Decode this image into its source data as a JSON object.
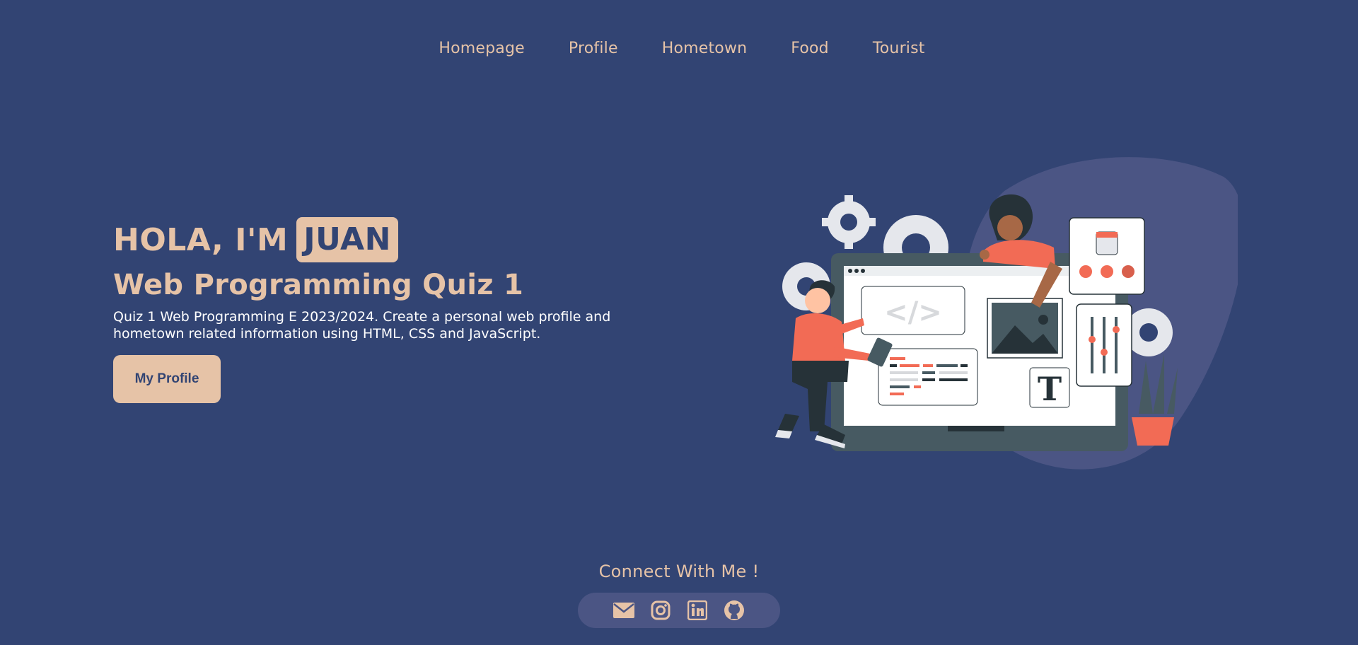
{
  "nav": {
    "items": [
      {
        "label": "Homepage"
      },
      {
        "label": "Profile"
      },
      {
        "label": "Hometown"
      },
      {
        "label": "Food"
      },
      {
        "label": "Tourist"
      }
    ]
  },
  "hero": {
    "greeting": "HOLA, I'M",
    "name": "JUAN",
    "subtitle": "Web Programming Quiz 1",
    "description": "Quiz 1 Web Programming E 2023/2024. Create a personal web profile and hometown related information using HTML, CSS and JavaScript.",
    "cta_label": "My Profile",
    "illustration_code_text": "</>",
    "illustration_text_glyph": "T"
  },
  "footer": {
    "connect_title": "Connect With Me !",
    "socials": [
      {
        "icon": "mail-icon"
      },
      {
        "icon": "instagram-icon"
      },
      {
        "icon": "linkedin-icon"
      },
      {
        "icon": "github-icon"
      }
    ]
  },
  "colors": {
    "background": "#324473",
    "accent": "#e6c3a7",
    "blob": "#4b5584",
    "coral": "#f26b55"
  }
}
